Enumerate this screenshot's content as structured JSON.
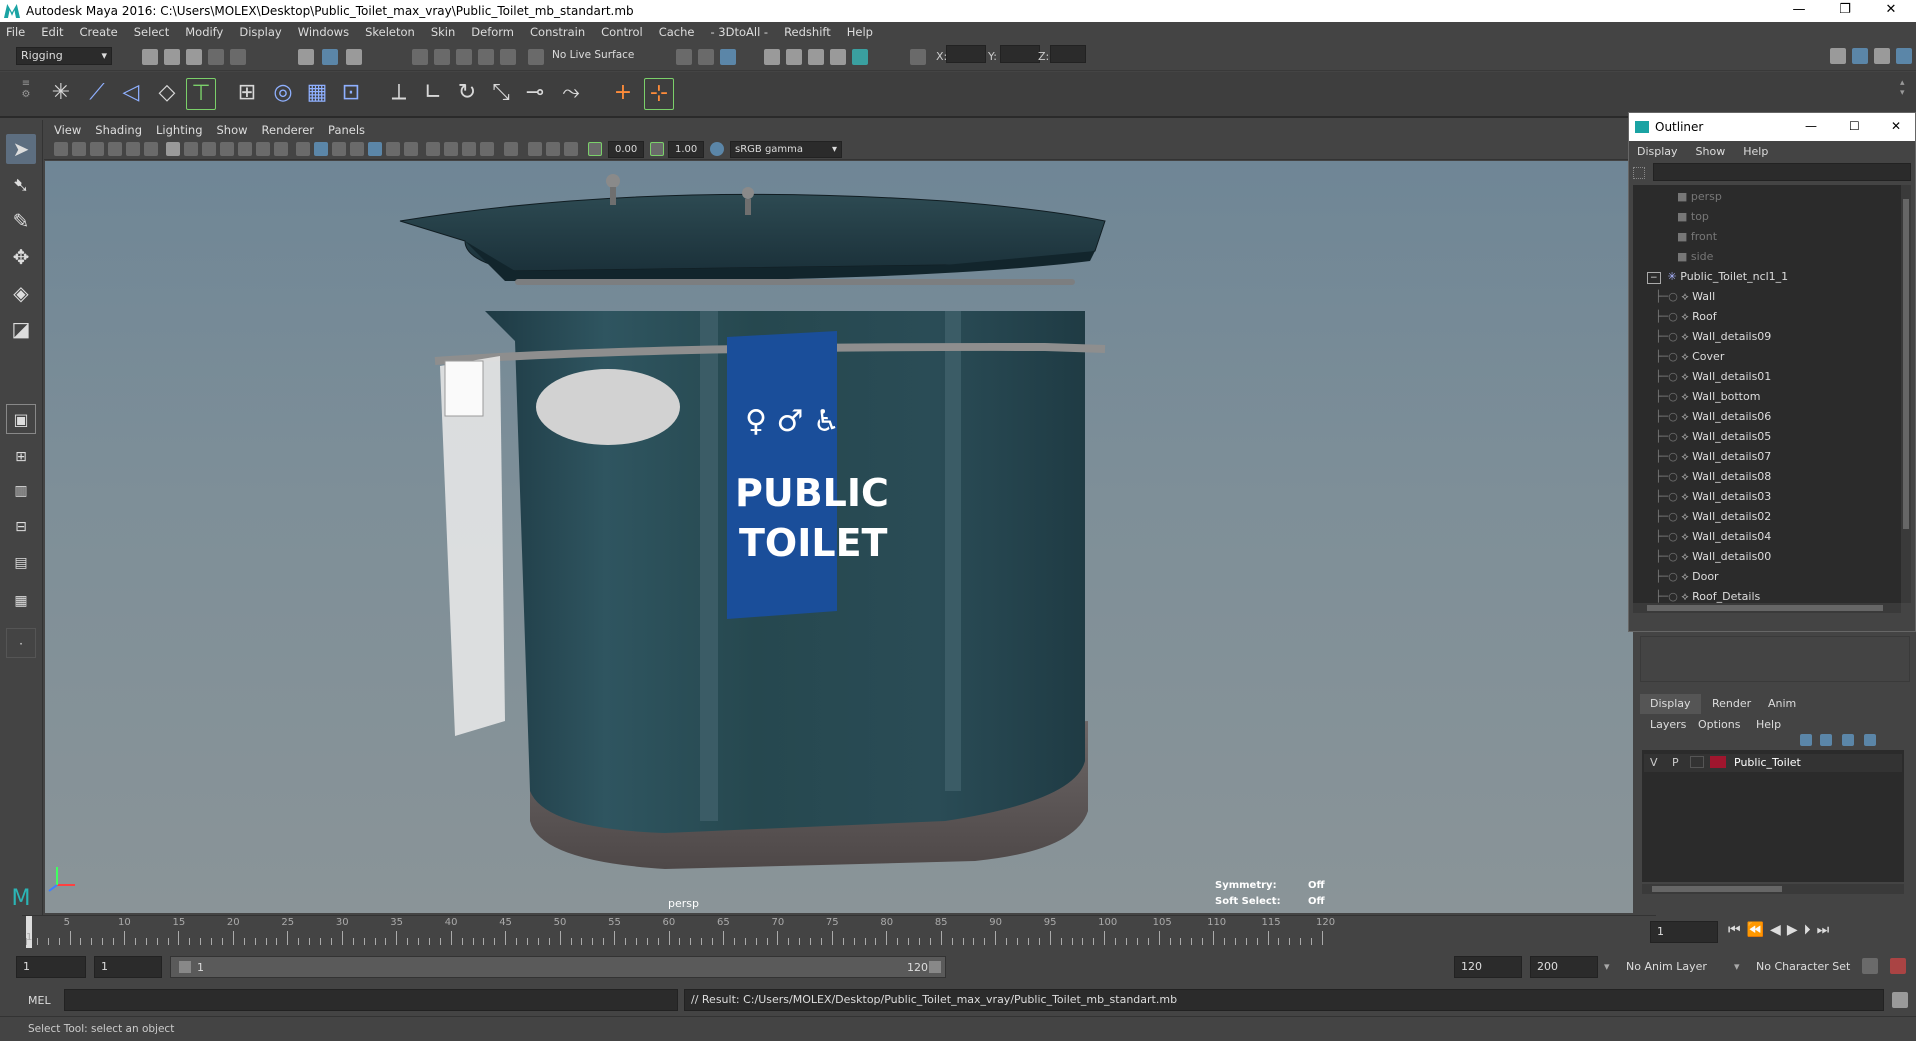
{
  "window": {
    "title": "Autodesk Maya 2016: C:\\Users\\MOLEX\\Desktop\\Public_Toilet_max_vray\\Public_Toilet_mb_standart.mb",
    "controls": [
      "—",
      "❐",
      "✕"
    ]
  },
  "menubar": [
    "File",
    "Edit",
    "Create",
    "Select",
    "Modify",
    "Display",
    "Windows",
    "Skeleton",
    "Skin",
    "Deform",
    "Constrain",
    "Control",
    "Cache",
    "- 3DtoAll -",
    "Redshift",
    "Help"
  ],
  "status_line": {
    "menu_set": "Rigging",
    "live_surface": "No Live Surface",
    "x_label": "X:",
    "y_label": "Y:",
    "z_label": "Z:"
  },
  "viewport": {
    "menu": [
      "View",
      "Shading",
      "Lighting",
      "Show",
      "Renderer",
      "Panels"
    ],
    "exposure": "0.00",
    "gamma": "1.00",
    "color_space": "sRGB gamma",
    "camera_label": "persp",
    "hud": [
      {
        "label": "Symmetry:",
        "value": "Off"
      },
      {
        "label": "Soft Select:",
        "value": "Off"
      }
    ],
    "sign_line1": "PUBLIC",
    "sign_line2": "TOILET"
  },
  "outliner": {
    "title": "Outliner",
    "controls": [
      "—",
      "☐",
      "✕"
    ],
    "menu": [
      "Display",
      "Show",
      "Help"
    ],
    "cameras": [
      "persp",
      "top",
      "front",
      "side"
    ],
    "root": "Public_Toilet_ncl1_1",
    "children": [
      "Wall",
      "Roof",
      "Wall_details09",
      "Cover",
      "Wall_details01",
      "Wall_bottom",
      "Wall_details06",
      "Wall_details05",
      "Wall_details07",
      "Wall_details08",
      "Wall_details03",
      "Wall_details02",
      "Wall_details04",
      "Wall_details00",
      "Door",
      "Roof_Details"
    ]
  },
  "layer_editor": {
    "tabs": [
      "Display",
      "Render",
      "Anim"
    ],
    "menu": [
      "Layers",
      "Options",
      "Help"
    ],
    "layer": {
      "v": "V",
      "p": "P",
      "name": "Public_Toilet",
      "color": "#a0162e"
    }
  },
  "timeline": {
    "ticks": [
      "5",
      "10",
      "15",
      "20",
      "25",
      "30",
      "35",
      "40",
      "45",
      "50",
      "55",
      "60",
      "65",
      "70",
      "75",
      "80",
      "85",
      "90",
      "95",
      "100",
      "105",
      "110",
      "115",
      "120"
    ],
    "first": "1",
    "current_frame": "1"
  },
  "range": {
    "start": "1",
    "playback_start": "1",
    "slider_start": "1",
    "slider_end": "120",
    "playback_end": "120",
    "end": "200",
    "anim_layer": "No Anim Layer",
    "character_set": "No Character Set"
  },
  "command": {
    "language": "MEL",
    "result": "// Result: C:/Users/MOLEX/Desktop/Public_Toilet_max_vray/Public_Toilet_mb_standart.mb"
  },
  "help_line": "Select Tool: select an object"
}
